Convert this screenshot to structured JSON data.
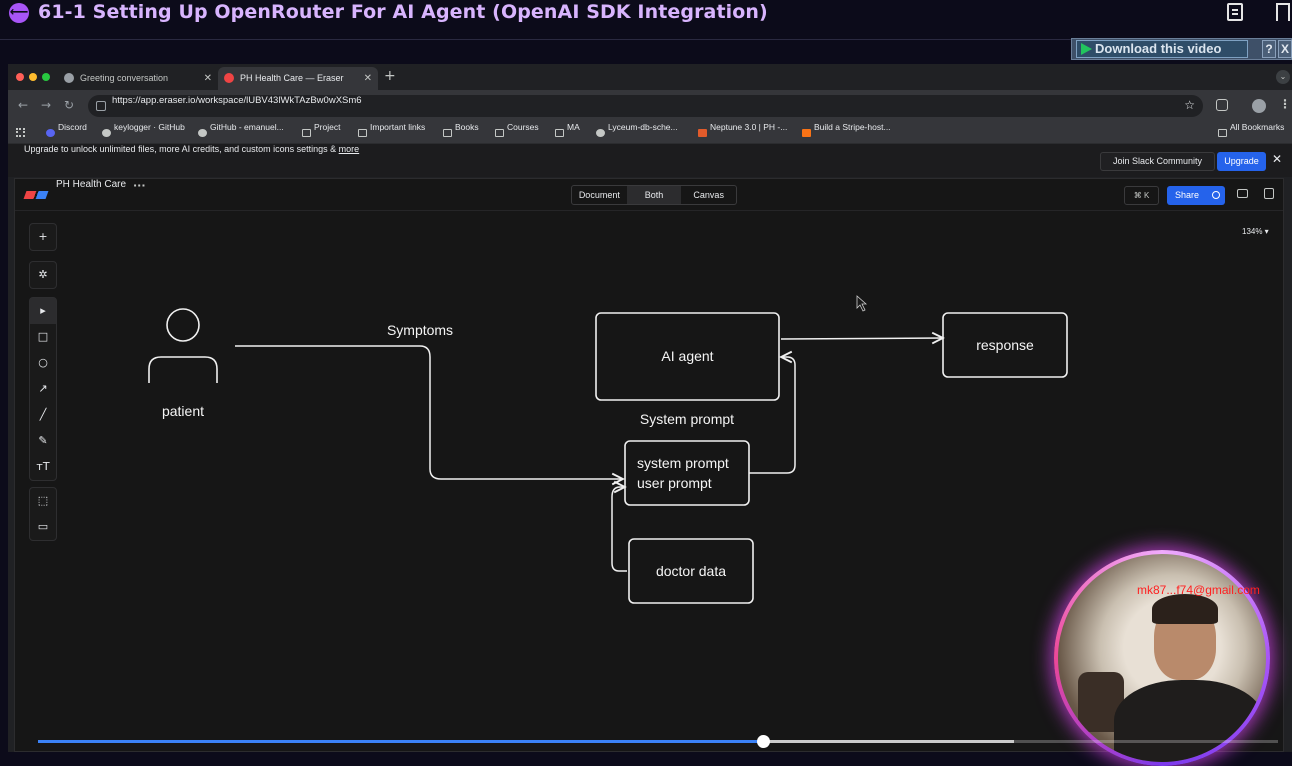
{
  "course": {
    "title": "61-1 Setting Up OpenRouter For AI Agent (OpenAI SDK Integration)",
    "download_label": "Download this video",
    "help_label": "?",
    "close_label": "X",
    "watermark_email": "mk87...f74@gmail.com"
  },
  "browser": {
    "tabs": [
      {
        "label": "Greeting conversation",
        "active": false
      },
      {
        "label": "PH Health Care — Eraser",
        "active": true
      }
    ],
    "url": "https://app.eraser.io/workspace/lUBV43lWkTAzBw0wXSm6",
    "bookmarks": [
      "Discord",
      "keylogger · GitHub",
      "GitHub - emanuel...",
      "Project",
      "Important links",
      "Books",
      "Courses",
      "MA",
      "Lyceum-db-sche...",
      "Neptune 3.0 | PH -...",
      "Build a Stripe-host...",
      "All Bookmarks"
    ]
  },
  "eraser": {
    "banner_text": "Upgrade to unlock unlimited files, more AI credits, and custom icons settings & ",
    "banner_link": "more",
    "join_slack": "Join Slack Community",
    "upgrade": "Upgrade",
    "doc_title": "PH Health Care",
    "view_modes": [
      "Document",
      "Both",
      "Canvas"
    ],
    "selected_view": "Both",
    "cmdk": "⌘ K",
    "share": "Share",
    "zoom": "134% ▾"
  },
  "diagram": {
    "actor": "patient",
    "edge_symptoms": "Symptoms",
    "node_agent": "AI agent",
    "node_response": "response",
    "edge_system_prompt": "System prompt",
    "node_prompts_line1": "system prompt",
    "node_prompts_line2": "user prompt",
    "node_doctor": "doctor data"
  },
  "player": {
    "progress": 0.585,
    "buffered": 0.787
  },
  "colors": {
    "accent": "#a855f7",
    "title": "#d8b4fe",
    "eraser_blue": "#2563eb",
    "progress": "#3b82f6",
    "watermark": "#ff2020"
  }
}
